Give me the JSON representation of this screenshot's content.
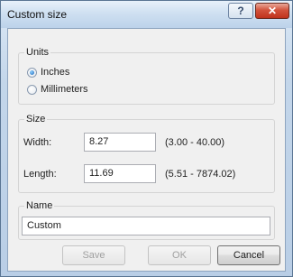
{
  "window": {
    "title": "Custom size",
    "help_label": "?",
    "close_label": "✕"
  },
  "units": {
    "group_label": "Units",
    "options": [
      {
        "label": "Inches",
        "selected": true
      },
      {
        "label": "Millimeters",
        "selected": false
      }
    ]
  },
  "size": {
    "group_label": "Size",
    "width_label": "Width:",
    "width_value": "8.27",
    "width_range": "(3.00 - 40.00)",
    "length_label": "Length:",
    "length_value": "11.69",
    "length_range": "(5.51 - 7874.02)"
  },
  "name": {
    "group_label": "Name",
    "value": "Custom"
  },
  "buttons": {
    "save": "Save",
    "ok": "OK",
    "cancel": "Cancel"
  }
}
